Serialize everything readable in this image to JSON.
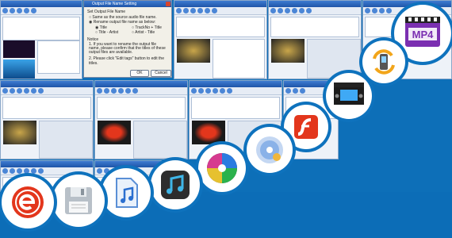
{
  "colors": {
    "background": "#0d6fb8",
    "circle": "#ffffff",
    "accent_red": "#e3361c",
    "accent_blue": "#2a7be0"
  },
  "dialog": {
    "title": "Output File Name Setting",
    "subtitle": "Set Output File Name",
    "option_same": "Same as the source audio file name.",
    "option_rename": "Rename output file name as below:",
    "choice_title": "Title",
    "choice_track": "TrackNo + Title",
    "choice_title_artist": "Title - Artist",
    "choice_artist_title": "Artist - Title",
    "notice_label": "Notice",
    "notice_1": "1. If you want to rename the output file name, please confirm that the titles of these output files are available.",
    "notice_2": "2. Please click \"Edit tags\" button to edit the titles.",
    "ok_label": "OK",
    "cancel_label": "Cancel"
  },
  "icons": [
    {
      "name": "mp4-icon",
      "label": "MP4"
    },
    {
      "name": "mobile-phone-convert-icon"
    },
    {
      "name": "psp-video-icon"
    },
    {
      "name": "flash-swf-icon"
    },
    {
      "name": "dvd-disc-icon"
    },
    {
      "name": "colorful-media-disc-icon"
    },
    {
      "name": "itunes-music-icon"
    },
    {
      "name": "audio-file-icon"
    },
    {
      "name": "floppy-disk-icon"
    },
    {
      "name": "red-e-logo-icon"
    }
  ]
}
